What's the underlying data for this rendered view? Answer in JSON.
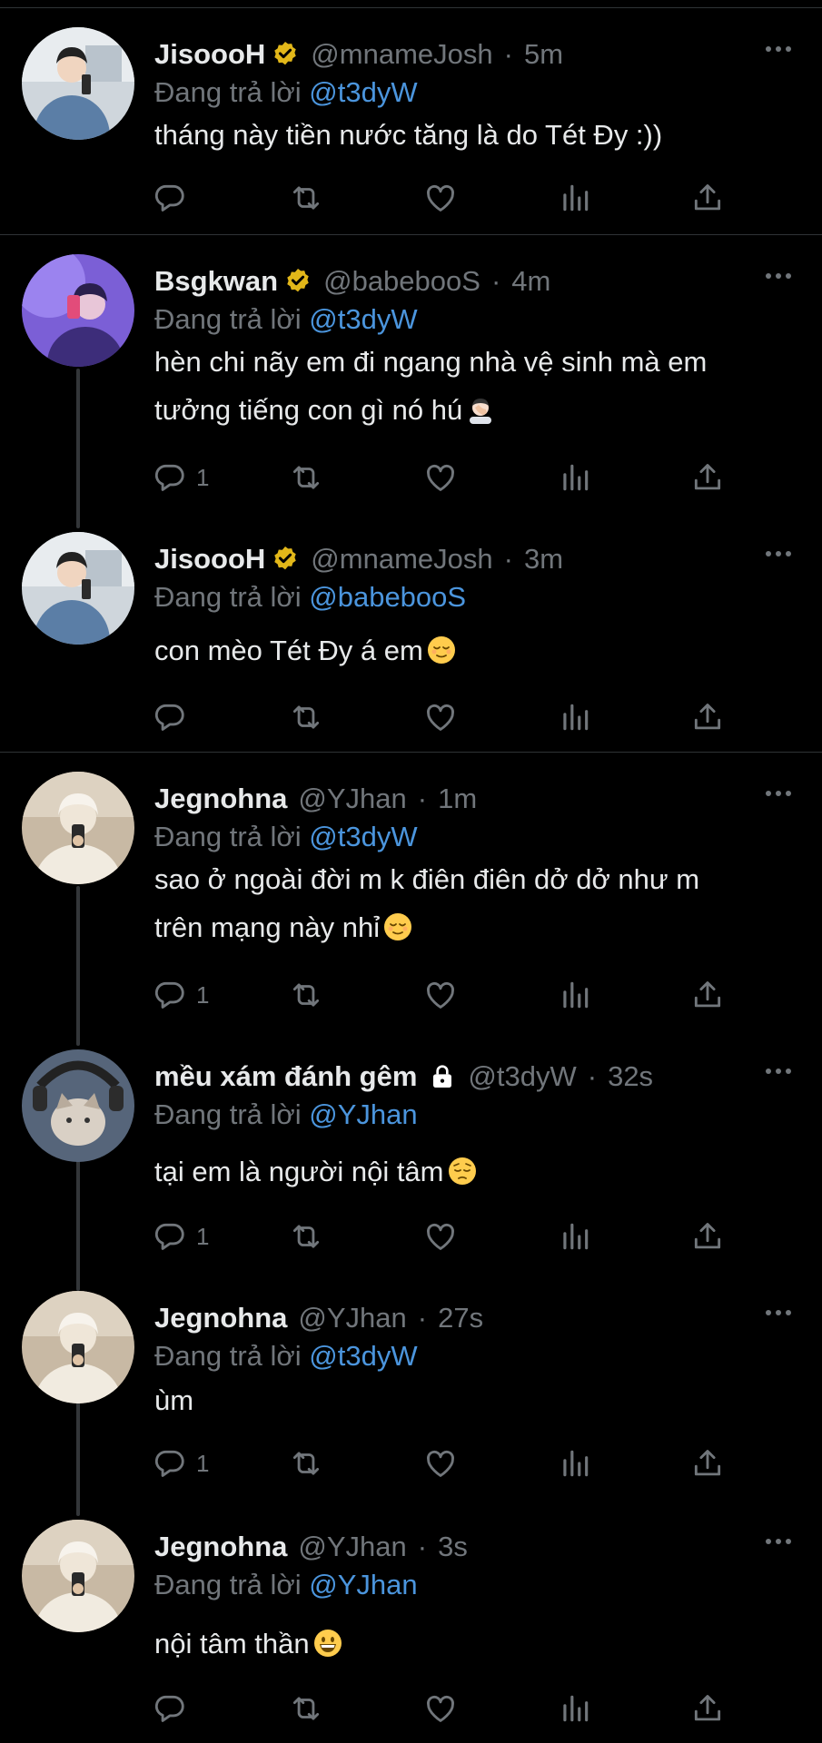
{
  "reply_prefix": "Đang trả lời",
  "colors": {
    "background": "#000000",
    "text": "#e7e9ea",
    "muted": "#71767b",
    "link": "#4b95dd",
    "verified": "#e2b719",
    "divider": "#2f3336"
  },
  "tweets": [
    {
      "name": "JisoooH",
      "verified": true,
      "handle": "@mnameJosh",
      "sep": "·",
      "time": "5m",
      "reply_to": "@t3dyW",
      "text": "tháng này tiền nước tăng là do Tét Đy :))",
      "emoji": "",
      "reply_count": ""
    },
    {
      "name": "Bsgkwan",
      "verified": true,
      "handle": "@babebooS",
      "sep": "·",
      "time": "4m",
      "reply_to": "@t3dyW",
      "text_line1": "hèn chi nãy em đi ngang nhà vệ sinh mà em",
      "text_line2": "tưởng tiếng con gì nó hú",
      "emoji": "man-facepalming",
      "reply_count": "1"
    },
    {
      "name": "JisoooH",
      "verified": true,
      "handle": "@mnameJosh",
      "sep": "·",
      "time": "3m",
      "reply_to": "@babebooS",
      "text": "con mèo Tét Đy á em",
      "emoji": "relieved-face",
      "reply_count": ""
    },
    {
      "name": "Jegnohna",
      "verified": false,
      "handle": "@YJhan",
      "sep": "·",
      "time": "1m",
      "reply_to": "@t3dyW",
      "text_line1": "sao ở ngoài đời m k điên điên dở dở như m",
      "text_line2": "trên mạng này nhỉ",
      "emoji": "relieved-face",
      "reply_count": "1"
    },
    {
      "name": "mều xám đánh gêm",
      "verified": false,
      "locked": true,
      "handle": "@t3dyW",
      "sep": "·",
      "time": "32s",
      "reply_to": "@YJhan",
      "text": "tại em là người nội tâm",
      "emoji": "pensive-face",
      "reply_count": "1"
    },
    {
      "name": "Jegnohna",
      "verified": false,
      "handle": "@YJhan",
      "sep": "·",
      "time": "27s",
      "reply_to": "@t3dyW",
      "text": "ùm",
      "emoji": "",
      "reply_count": "1"
    },
    {
      "name": "Jegnohna",
      "verified": false,
      "handle": "@YJhan",
      "sep": "·",
      "time": "3s",
      "reply_to": "@YJhan",
      "text": "nội tâm thần",
      "emoji": "grinning-face",
      "reply_count": ""
    }
  ]
}
